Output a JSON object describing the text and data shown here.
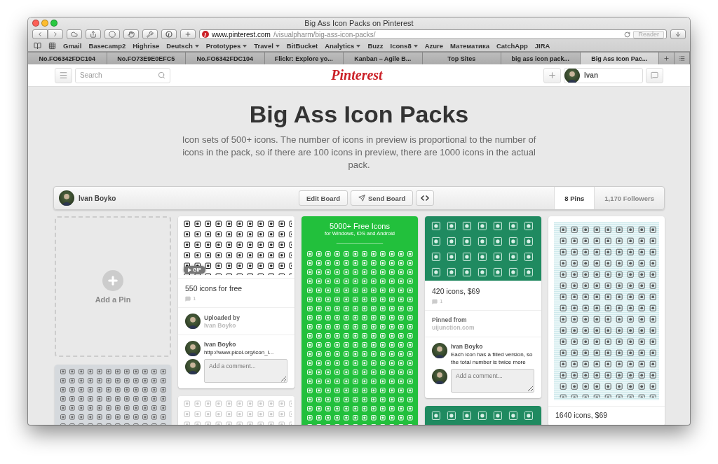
{
  "window": {
    "title": "Big Ass Icon Packs on Pinterest"
  },
  "address_bar": {
    "domain": "www.pinterest.com",
    "path": "/visualpharm/big-ass-icon-packs/"
  },
  "reader_button": "Reader",
  "bookmarks": [
    {
      "label": "Gmail",
      "menu": false
    },
    {
      "label": "Basecamp2",
      "menu": false
    },
    {
      "label": "Highrise",
      "menu": false
    },
    {
      "label": "Deutsch",
      "menu": true
    },
    {
      "label": "Prototypes",
      "menu": true
    },
    {
      "label": "Travel",
      "menu": true
    },
    {
      "label": "BitBucket",
      "menu": false
    },
    {
      "label": "Analytics",
      "menu": true
    },
    {
      "label": "Buzz",
      "menu": false
    },
    {
      "label": "Icons8",
      "menu": true
    },
    {
      "label": "Azure",
      "menu": false
    },
    {
      "label": "Математика",
      "menu": false
    },
    {
      "label": "CatchApp",
      "menu": false
    },
    {
      "label": "JIRA",
      "menu": false
    }
  ],
  "tabs": [
    {
      "label": "No.FO6342FDC104",
      "selected": false
    },
    {
      "label": "No.FO73E9E0EFC5",
      "selected": false
    },
    {
      "label": "No.FO6342FDC104",
      "selected": false
    },
    {
      "label": "Flickr: Explore yo...",
      "selected": false
    },
    {
      "label": "Kanban – Agile B...",
      "selected": false
    },
    {
      "label": "Top Sites",
      "selected": false
    },
    {
      "label": "big ass icon pack...",
      "selected": false
    },
    {
      "label": "Big Ass Icon Pac...",
      "selected": true
    }
  ],
  "site_header": {
    "search": {
      "placeholder": "Search"
    },
    "logo": "Pinterest",
    "user": "Ivan"
  },
  "board": {
    "title": "Big Ass Icon Packs",
    "description": "Icon sets of 500+ icons. The number of icons in preview is proportional to the number of icons in the pack, so if there are 100 icons in preview, there are 1000 icons in the actual pack.",
    "owner": "Ivan Boyko",
    "buttons": [
      {
        "label": "Edit Board",
        "kind": "plain"
      },
      {
        "label": "Send Board",
        "kind": "send"
      }
    ],
    "stats": [
      {
        "label": "8 Pins",
        "selected": true
      },
      {
        "label": "1,170 Followers",
        "selected": false
      }
    ]
  },
  "columns": [
    [
      {
        "kind": "add",
        "label": "Add a Pin"
      },
      {
        "kind": "picture"
      }
    ],
    [
      {
        "kind": "pin",
        "badge": "GIF",
        "caption": "550 icons for free",
        "comment_count": "1",
        "source": {
          "kind": "uploader",
          "label": "Uploaded by",
          "value": "Ivan Boyko"
        },
        "comments": [
          {
            "author": "Ivan Boyko",
            "text": "http://www.picol.org/icon_l..."
          }
        ],
        "comment_placeholder": "Add a comment..."
      },
      {
        "kind": "picture"
      }
    ],
    [
      {
        "kind": "poster",
        "heading": "5000+ Free Icons",
        "subheading": "for Windows, iOS and Android"
      }
    ],
    [
      {
        "kind": "pin",
        "caption": "420 icons, $69",
        "comment_count": "1",
        "source": {
          "kind": "site",
          "label": "Pinned from",
          "value": "uijunction.com"
        },
        "comments": [
          {
            "author": "Ivan Boyko",
            "text": "Each icon has a filled version, so the total number is twice more"
          }
        ],
        "comment_placeholder": "Add a comment..."
      },
      {
        "kind": "picture"
      }
    ],
    [
      {
        "kind": "framed",
        "caption": "1640 icons, $69"
      }
    ]
  ]
}
